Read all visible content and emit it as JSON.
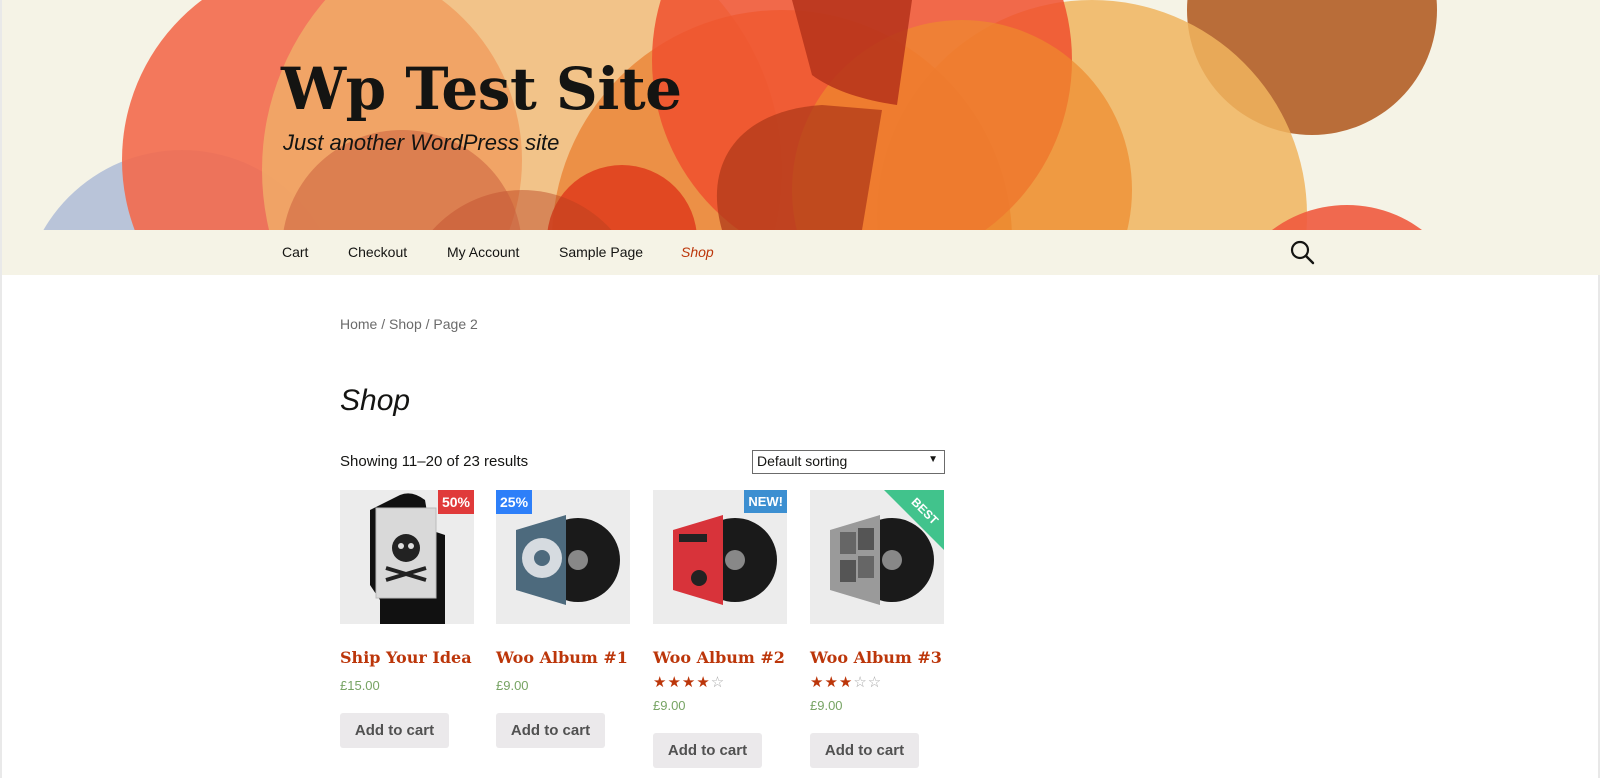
{
  "site": {
    "title": "Wp Test Site",
    "tagline": "Just another WordPress site"
  },
  "nav": {
    "items": [
      {
        "label": "Cart"
      },
      {
        "label": "Checkout"
      },
      {
        "label": "My Account"
      },
      {
        "label": "Sample Page"
      },
      {
        "label": "Shop"
      }
    ],
    "active": "Shop",
    "search_icon": "search-icon"
  },
  "breadcrumb": {
    "home": "Home",
    "sep1": " / ",
    "shop": "Shop",
    "sep2": " / ",
    "current": "Page 2"
  },
  "page": {
    "title": "Shop",
    "result_count": "Showing 11–20 of 23 results",
    "sorting": "Default sorting"
  },
  "products": [
    {
      "name": "Ship Your Idea",
      "price": "£15.00",
      "badge": "50%",
      "badge_color": "#e03a3a",
      "rating": null,
      "button": "Add to cart"
    },
    {
      "name": "Woo Album #1",
      "price": "£9.00",
      "badge": "25%",
      "badge_color": "#2d7ff9",
      "rating": null,
      "button": "Add to cart"
    },
    {
      "name": "Woo Album #2",
      "price": "£9.00",
      "badge": "NEW!",
      "badge_color": "#3c8fd1",
      "rating": 4,
      "button": "Add to cart"
    },
    {
      "name": "Woo Album #3",
      "price": "£9.00",
      "badge": "BEST",
      "badge_color": "#41c38c",
      "rating": 3,
      "button": "Add to cart"
    }
  ],
  "colors": {
    "accent": "#bc360a",
    "header_bg": "#f5f3e6",
    "price": "#77a464"
  }
}
